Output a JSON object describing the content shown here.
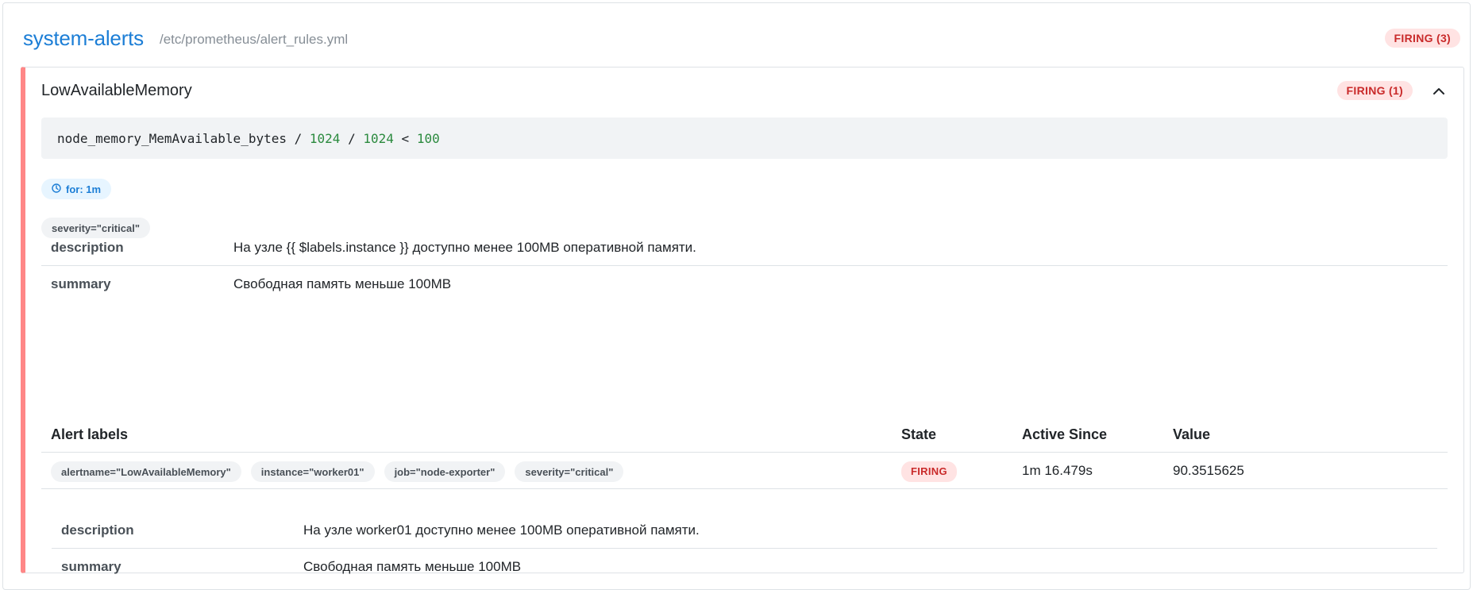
{
  "group": {
    "name": "system-alerts",
    "file": "/etc/prometheus/alert_rules.yml",
    "state_badge": "FIRING (3)"
  },
  "rule": {
    "name": "LowAvailableMemory",
    "state_badge": "FIRING (1)",
    "expr": {
      "metric": "node_memory_MemAvailable_bytes",
      "op1": "/",
      "num1": "1024",
      "op2": "/",
      "num2": "1024",
      "op3": "<",
      "num3": "100"
    },
    "for": "for: 1m",
    "labels": [
      "severity=\"critical\""
    ],
    "annotations": [
      {
        "key": "description",
        "value": "На узле {{ $labels.instance }} доступно менее 100MB оперативной памяти."
      },
      {
        "key": "summary",
        "value": "Свободная память меньше 100MB"
      }
    ]
  },
  "alerts_table": {
    "headers": {
      "labels": "Alert labels",
      "state": "State",
      "active_since": "Active Since",
      "value": "Value"
    },
    "rows": [
      {
        "labels": [
          "alertname=\"LowAvailableMemory\"",
          "instance=\"worker01\"",
          "job=\"node-exporter\"",
          "severity=\"critical\""
        ],
        "state": "FIRING",
        "active_since": "1m 16.479s",
        "value": "90.3515625",
        "annotations": [
          {
            "key": "description",
            "value": "На узле worker01 доступно менее 100MB оперативной памяти."
          },
          {
            "key": "summary",
            "value": "Свободная память меньше 100MB"
          }
        ]
      }
    ]
  },
  "icons": {
    "clock": "clock-icon",
    "collapse": "chevron-up-icon"
  },
  "colors": {
    "accent": "#1c7ed6",
    "firing_bg": "#ffe3e3",
    "firing_text": "#c92a2a",
    "card_border_firing": "#ff8787",
    "number": "#2b8a3e"
  }
}
